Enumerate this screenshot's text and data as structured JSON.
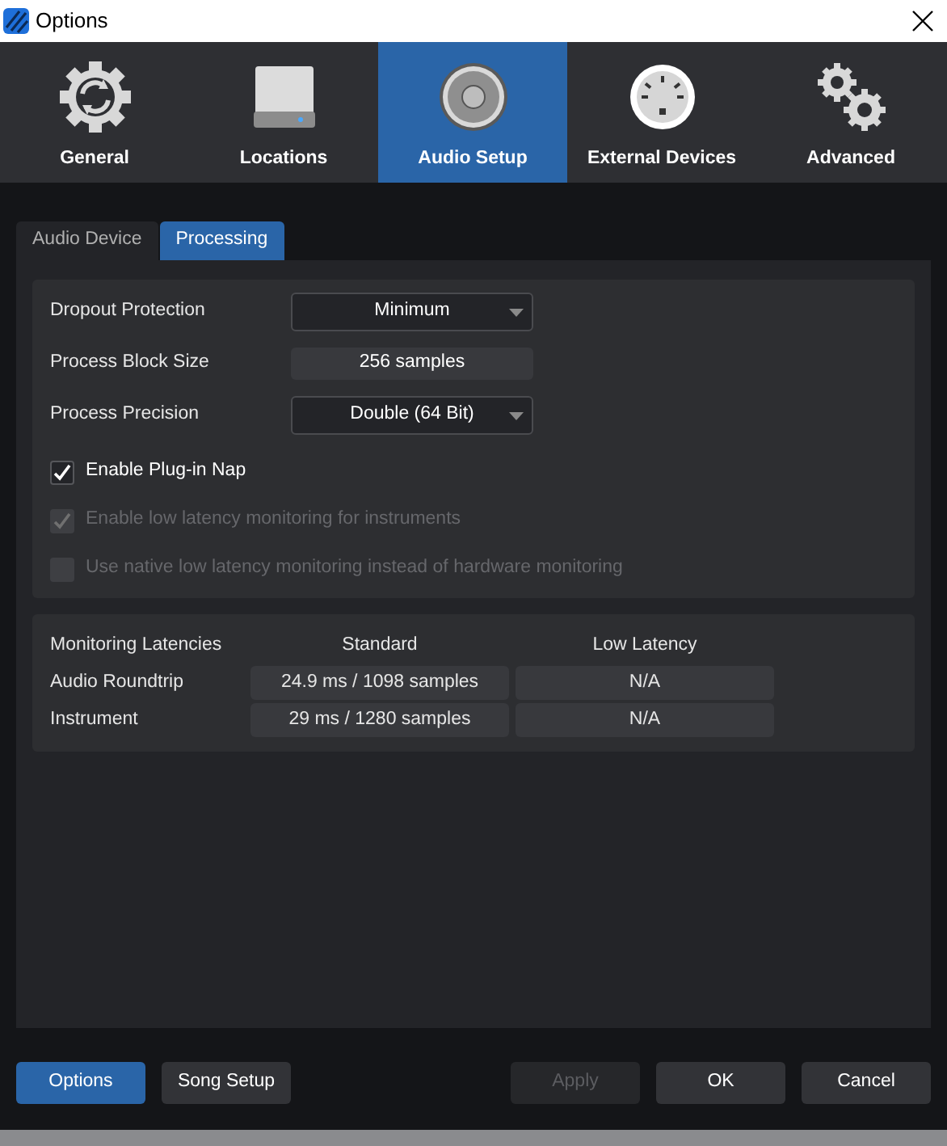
{
  "window": {
    "title": "Options"
  },
  "categories": [
    {
      "label": "General",
      "kind": "gear",
      "selected": false
    },
    {
      "label": "Locations",
      "kind": "drive",
      "selected": false
    },
    {
      "label": "Audio Setup",
      "kind": "speaker",
      "selected": true
    },
    {
      "label": "External Devices",
      "kind": "connector",
      "selected": false
    },
    {
      "label": "Advanced",
      "kind": "gears",
      "selected": false
    }
  ],
  "subtabs": [
    {
      "label": "Audio Device",
      "selected": false
    },
    {
      "label": "Processing",
      "selected": true
    }
  ],
  "settings": [
    {
      "kind": "dropdown",
      "label": "Dropout Protection",
      "value": "Minimum"
    },
    {
      "kind": "readout",
      "label": "Process Block Size",
      "value": "256 samples"
    },
    {
      "kind": "dropdown",
      "label": "Process Precision",
      "value": "Double (64 Bit)"
    }
  ],
  "checkboxes": [
    {
      "label": "Enable Plug-in Nap",
      "checked": true,
      "disabled": false
    },
    {
      "label": "Enable low latency monitoring for instruments",
      "checked": true,
      "disabled": true
    },
    {
      "label": "Use native low latency monitoring instead of hardware monitoring",
      "checked": false,
      "disabled": true
    }
  ],
  "latency": {
    "columns": [
      "Monitoring Latencies",
      "Standard",
      "Low Latency"
    ],
    "rows": [
      {
        "label": "Audio Roundtrip",
        "standard": "24.9 ms / 1098 samples",
        "low_latency": "N/A"
      },
      {
        "label": "Instrument",
        "standard": "29 ms / 1280 samples",
        "low_latency": "N/A"
      }
    ]
  },
  "buttons": [
    {
      "label": "Options",
      "kind": "primary",
      "disabled": false
    },
    {
      "label": "Song Setup",
      "kind": "secondary",
      "disabled": false
    },
    {
      "label": "Apply",
      "kind": "right",
      "disabled": true
    },
    {
      "label": "OK",
      "kind": "right",
      "disabled": false
    },
    {
      "label": "Cancel",
      "kind": "right",
      "disabled": false
    }
  ]
}
